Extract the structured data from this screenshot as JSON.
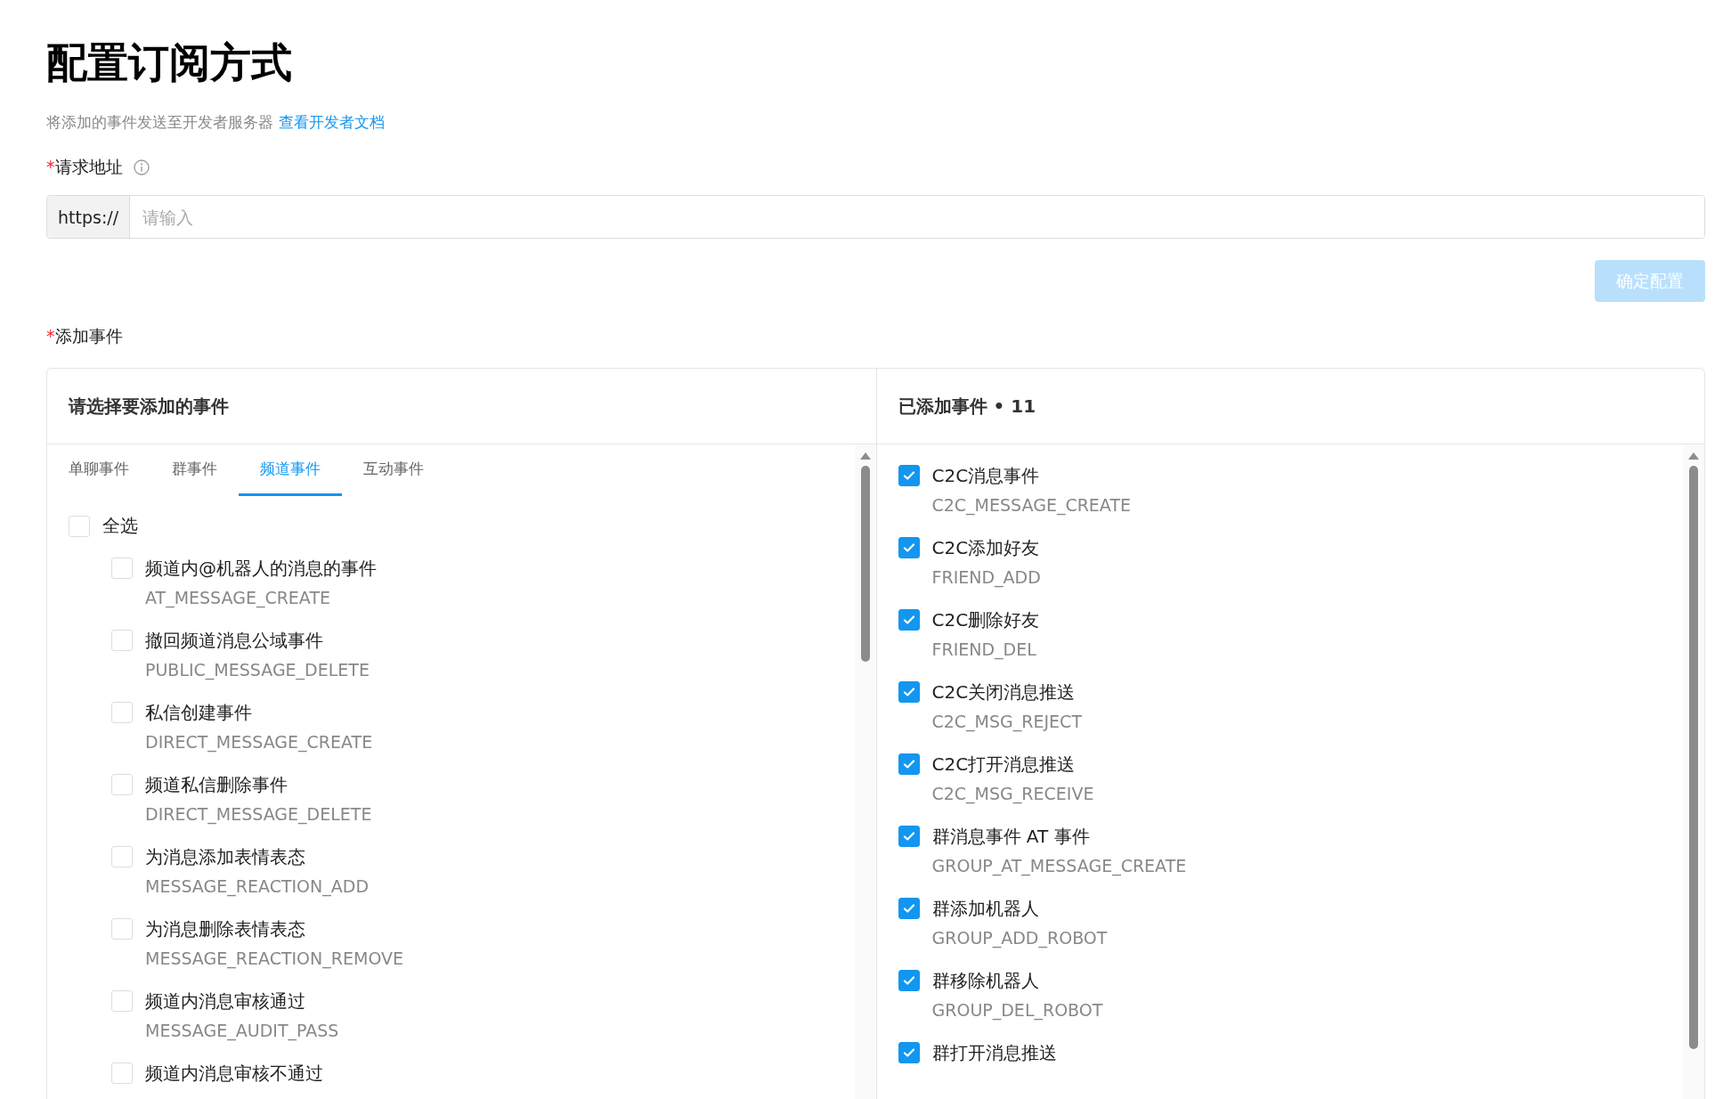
{
  "title": "配置订阅方式",
  "description": {
    "text": "将添加的事件发送至开发者服务器",
    "link": "查看开发者文档"
  },
  "url_field": {
    "required_mark": "*",
    "label": "请求地址",
    "prefix": "https://",
    "placeholder": "请输入"
  },
  "confirm_button": {
    "label": "确定配置",
    "disabled": true
  },
  "events_label": {
    "required_mark": "*",
    "label": "添加事件"
  },
  "available": {
    "title": "请选择要添加的事件",
    "tabs": [
      {
        "label": "单聊事件",
        "selected": false
      },
      {
        "label": "群事件",
        "selected": false
      },
      {
        "label": "频道事件",
        "selected": true
      },
      {
        "label": "互动事件",
        "selected": false
      }
    ],
    "select_all": {
      "label": "全选",
      "checked": false
    },
    "events": [
      {
        "name": "频道内@机器人的消息的事件",
        "code": "AT_MESSAGE_CREATE",
        "checked": false
      },
      {
        "name": "撤回频道消息公域事件",
        "code": "PUBLIC_MESSAGE_DELETE",
        "checked": false
      },
      {
        "name": "私信创建事件",
        "code": "DIRECT_MESSAGE_CREATE",
        "checked": false
      },
      {
        "name": "频道私信删除事件",
        "code": "DIRECT_MESSAGE_DELETE",
        "checked": false
      },
      {
        "name": "为消息添加表情表态",
        "code": "MESSAGE_REACTION_ADD",
        "checked": false
      },
      {
        "name": "为消息删除表情表态",
        "code": "MESSAGE_REACTION_REMOVE",
        "checked": false
      },
      {
        "name": "频道内消息审核通过",
        "code": "MESSAGE_AUDIT_PASS",
        "checked": false
      },
      {
        "name": "频道内消息审核不通过",
        "checked": false
      }
    ]
  },
  "added": {
    "title": "已添加事件",
    "separator": "•",
    "count": "11",
    "events": [
      {
        "name": "C2C消息事件",
        "code": "C2C_MESSAGE_CREATE",
        "checked": true
      },
      {
        "name": "C2C添加好友",
        "code": "FRIEND_ADD",
        "checked": true
      },
      {
        "name": "C2C删除好友",
        "code": "FRIEND_DEL",
        "checked": true
      },
      {
        "name": "C2C关闭消息推送",
        "code": "C2C_MSG_REJECT",
        "checked": true
      },
      {
        "name": "C2C打开消息推送",
        "code": "C2C_MSG_RECEIVE",
        "checked": true
      },
      {
        "name": "群消息事件 AT 事件",
        "code": "GROUP_AT_MESSAGE_CREATE",
        "checked": true
      },
      {
        "name": "群添加机器人",
        "code": "GROUP_ADD_ROBOT",
        "checked": true
      },
      {
        "name": "群移除机器人",
        "code": "GROUP_DEL_ROBOT",
        "checked": true
      },
      {
        "name": "群打开消息推送",
        "checked": true
      }
    ]
  }
}
